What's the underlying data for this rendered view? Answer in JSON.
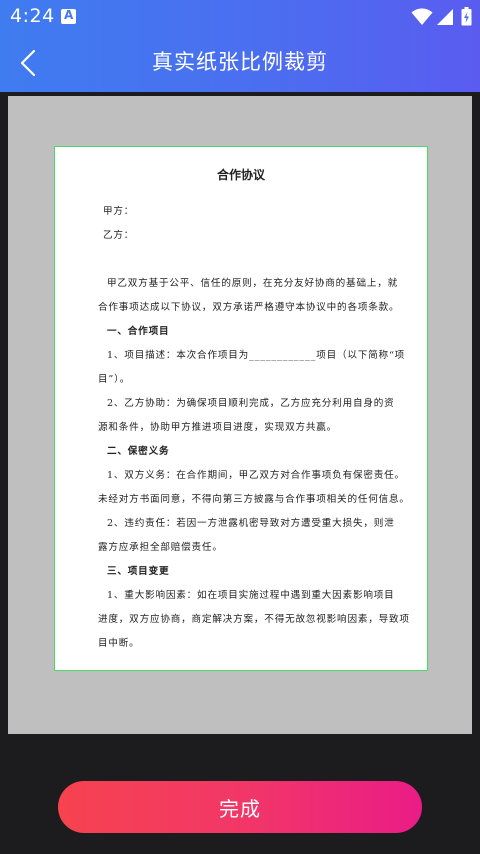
{
  "status": {
    "time": "4:24"
  },
  "header": {
    "title": "真实纸张比例裁剪"
  },
  "document": {
    "title": "合作协议",
    "lines": [
      "甲方：",
      "乙方：",
      "甲乙双方基于公平、信任的原则，在充分友好协商的基础上，就",
      "合作事项达成以下协议，双方承诺严格遵守本协议中的各项条款。",
      "一、合作项目",
      "1、项目描述：本次合作项目为____________项目（以下简称“项",
      "目”）。",
      "2、乙方协助：为确保项目顺利完成，乙方应充分利用自身的资",
      "源和条件，协助甲方推进项目进度，实现双方共赢。",
      "二、保密义务",
      "1、双方义务：在合作期间，甲乙双方对合作事项负有保密责任。",
      "未经对方书面同意，不得向第三方披露与合作事项相关的任何信息。",
      "2、违约责任：若因一方泄露机密导致对方遭受重大损失，则泄",
      "露方应承担全部赔偿责任。",
      "三、项目变更",
      "1、重大影响因素：如在项目实施过程中遇到重大因素影响项目",
      "进度，双方应协商，商定解决方案，不得无故忽视影响因素，导致项",
      "目中断。"
    ]
  },
  "footer": {
    "done_label": "完成"
  },
  "colors": {
    "accent_blue": "#4b6ef0",
    "button_red": "#f7424f",
    "button_pink": "#ea1c86",
    "crop_border": "#4cd964"
  }
}
